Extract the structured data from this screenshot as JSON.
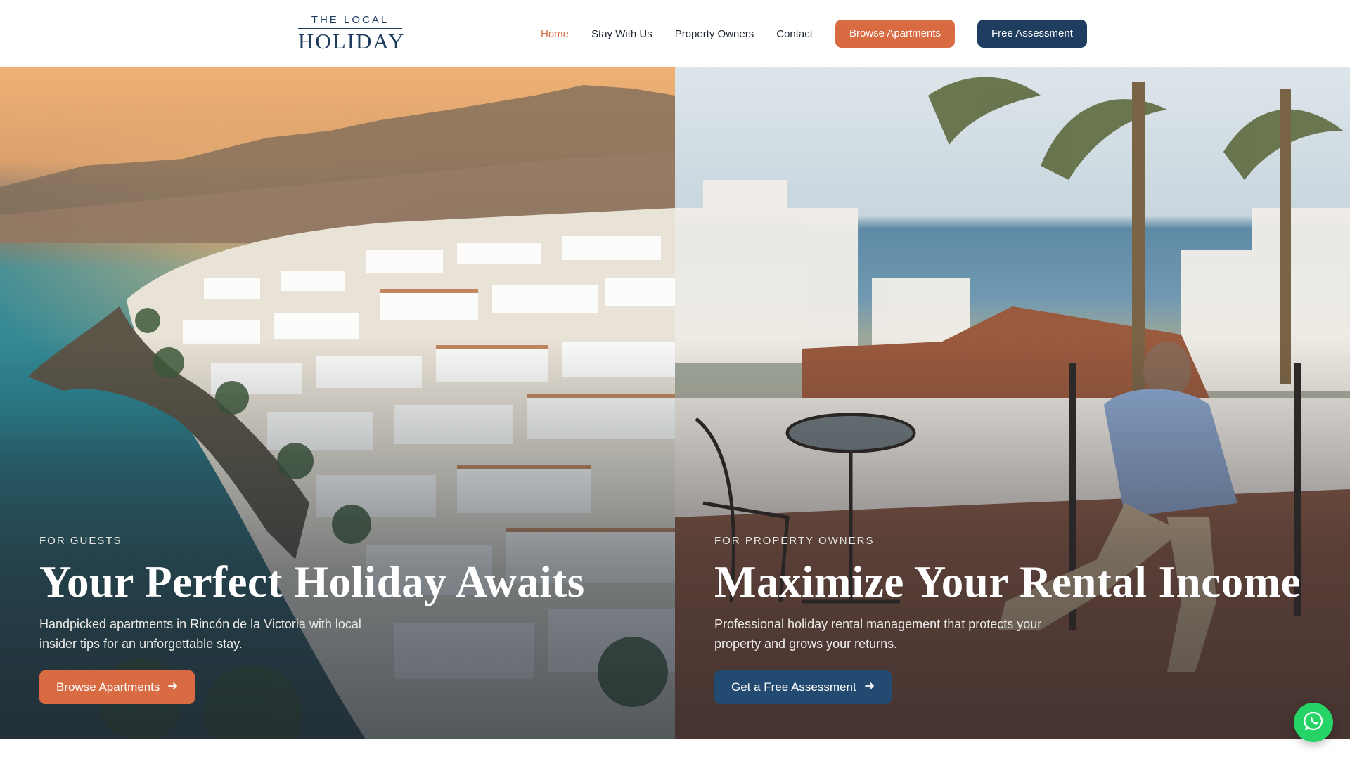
{
  "brand": {
    "logo_top": "THE LOCAL",
    "logo_bottom": "HOLIDAY"
  },
  "nav": {
    "links": [
      {
        "label": "Home",
        "active": true
      },
      {
        "label": "Stay With Us",
        "active": false
      },
      {
        "label": "Property Owners",
        "active": false
      },
      {
        "label": "Contact",
        "active": false
      }
    ],
    "browse_label": "Browse Apartments",
    "assessment_label": "Free Assessment"
  },
  "hero": {
    "guests": {
      "eyebrow": "FOR GUESTS",
      "headline": "Your Perfect Holiday Awaits",
      "subtext": "Handpicked apartments in Rincón de la Victoria with local insider tips for an unforgettable stay.",
      "cta": "Browse Apartments"
    },
    "owners": {
      "eyebrow": "FOR PROPERTY OWNERS",
      "headline": "Maximize Your Rental Income",
      "subtext": "Professional holiday rental management that protects your property and grows your returns.",
      "cta": "Get a Free Assessment"
    }
  },
  "icons": {
    "arrow": "arrow-right-icon",
    "whatsapp": "whatsapp-icon"
  },
  "colors": {
    "accent": "#d96b43",
    "navy": "#1e3d5f",
    "whatsapp": "#25d366"
  }
}
